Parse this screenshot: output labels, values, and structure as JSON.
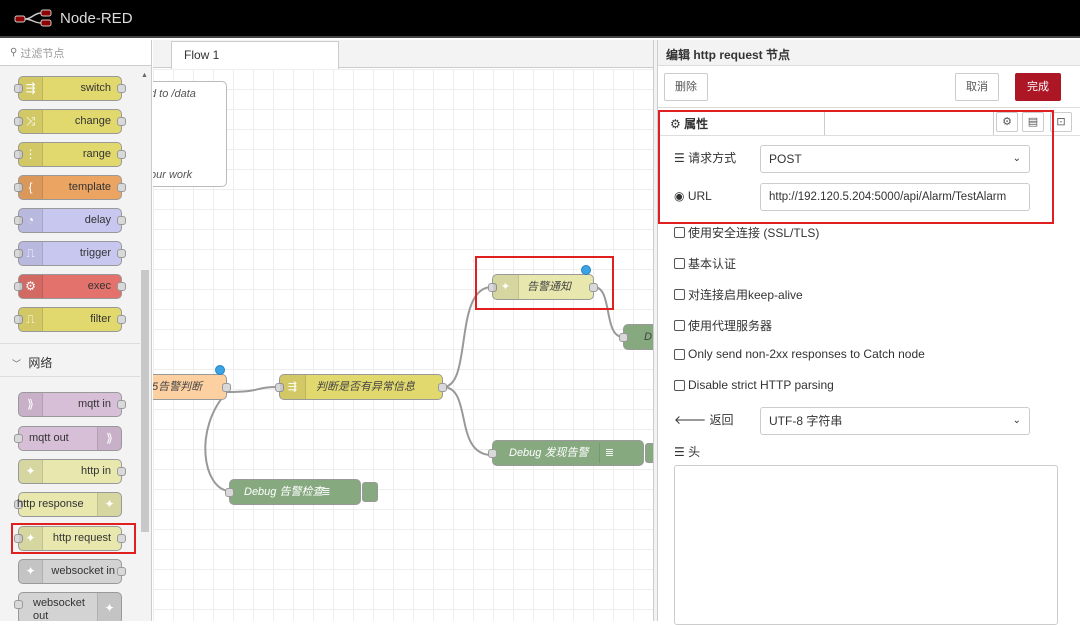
{
  "app": {
    "title": "Node-RED"
  },
  "palette": {
    "search_placeholder": "过滤节点",
    "nodes": [
      {
        "label": "switch",
        "color": "#e2d96e",
        "icon": "switch-icon",
        "glyph": "⇶"
      },
      {
        "label": "change",
        "color": "#e2d96e",
        "icon": "change-icon",
        "glyph": "⤨"
      },
      {
        "label": "range",
        "color": "#e2d96e",
        "icon": "range-icon",
        "glyph": "⋮"
      },
      {
        "label": "template",
        "color": "#eba462",
        "icon": "template-icon",
        "glyph": "{"
      },
      {
        "label": "delay",
        "color": "#c7c7f0",
        "icon": "delay-icon",
        "glyph": "◔"
      },
      {
        "label": "trigger",
        "color": "#c7c7f0",
        "icon": "trigger-icon",
        "glyph": "⎍"
      },
      {
        "label": "exec",
        "color": "#e2726b",
        "icon": "exec-icon",
        "glyph": "⚙"
      },
      {
        "label": "filter",
        "color": "#e2d96e",
        "icon": "filter-icon",
        "glyph": "⎍"
      }
    ],
    "category": "网络",
    "network_nodes": [
      {
        "label": "mqtt in",
        "color": "#d8bfd8",
        "icon": "mqtt-icon",
        "glyph": "⟫"
      },
      {
        "label": "mqtt out",
        "color": "#d8bfd8",
        "icon": "mqtt-icon",
        "glyph": "⟫"
      },
      {
        "label": "http in",
        "color": "#e7e7ae",
        "icon": "globe-icon",
        "glyph": "✦"
      },
      {
        "label": "http response",
        "color": "#e7e7ae",
        "icon": "globe-icon",
        "glyph": "✦"
      },
      {
        "label": "http request",
        "color": "#e7e7ae",
        "icon": "globe-icon",
        "glyph": "✦"
      },
      {
        "label": "websocket in",
        "color": "#d3d3d3",
        "icon": "websocket-icon",
        "glyph": "✦"
      },
      {
        "label": "websocket out",
        "color": "#d3d3d3",
        "icon": "websocket-icon",
        "glyph": "✦"
      }
    ]
  },
  "workspace": {
    "tab": "Flow 1",
    "comment_lines": [
      "d to /data",
      "our work"
    ],
    "nodes": {
      "alarm_notify": "告警通知",
      "alarm_check_fn": "5告警判断",
      "switch_node": "判断是否有异常信息",
      "debug_found": "Debug 发现告警",
      "debug_check": "Debug 告警检查",
      "debug_partial": "D"
    }
  },
  "editor": {
    "title": "编辑 http request 节点",
    "delete": "删除",
    "cancel": "取消",
    "done": "完成",
    "properties_tab": "属性",
    "method_label": "请求方式",
    "method_value": "POST",
    "url_label": "URL",
    "url_value": "http://192.120.5.204:5000/api/Alarm/TestAlarm",
    "cb_ssl": "使用安全连接 (SSL/TLS)",
    "cb_auth": "基本认证",
    "cb_keepalive": "对连接启用keep-alive",
    "cb_proxy": "使用代理服务器",
    "cb_non2xx": "Only send non-2xx responses to Catch node",
    "cb_strict": "Disable strict HTTP parsing",
    "return_label": "返回",
    "return_value": "UTF-8 字符串",
    "headers_label": "头"
  }
}
